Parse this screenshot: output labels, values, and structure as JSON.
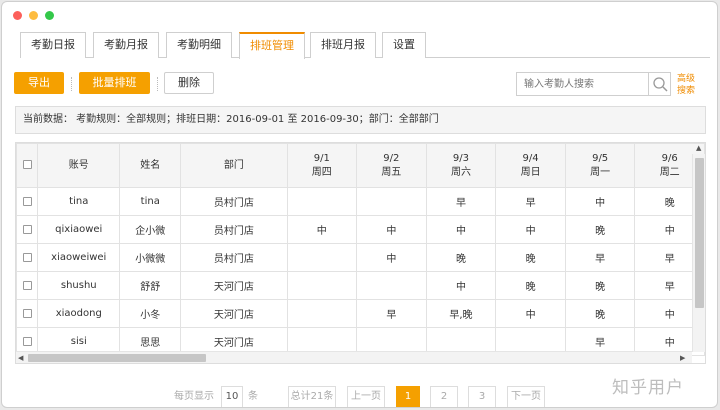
{
  "window": {
    "dot_colors": [
      "#fc605b",
      "#fdbc40",
      "#34c84a"
    ]
  },
  "tabs": [
    {
      "label": "考勤日报",
      "active": false
    },
    {
      "label": "考勤月报",
      "active": false
    },
    {
      "label": "考勤明细",
      "active": false
    },
    {
      "label": "排班管理",
      "active": true
    },
    {
      "label": "排班月报",
      "active": false
    },
    {
      "label": "设置",
      "active": false
    }
  ],
  "toolbar": {
    "export_label": "导出",
    "batch_label": "批量排班",
    "delete_label": "删除",
    "search_placeholder": "输入考勤人搜索",
    "advanced_search_label": "高级搜索"
  },
  "filter_info": "当前数据： 考勤规则：全部规则；排班日期：2016-09-01 至 2016-09-30；部门：全部部门",
  "table": {
    "columns": {
      "account": "账号",
      "name": "姓名",
      "department": "部门"
    },
    "dates": [
      {
        "date": "9/1",
        "weekday": "周四"
      },
      {
        "date": "9/2",
        "weekday": "周五"
      },
      {
        "date": "9/3",
        "weekday": "周六"
      },
      {
        "date": "9/4",
        "weekday": "周日"
      },
      {
        "date": "9/5",
        "weekday": "周一"
      },
      {
        "date": "9/6",
        "weekday": "周二"
      }
    ],
    "rows": [
      {
        "account": "tina",
        "name": "tina",
        "department": "员村门店",
        "shifts": [
          "",
          "",
          "早",
          "早",
          "中",
          "晚"
        ]
      },
      {
        "account": "qixiaowei",
        "name": "企小微",
        "department": "员村门店",
        "shifts": [
          "中",
          "中",
          "中",
          "中",
          "晚",
          "中"
        ]
      },
      {
        "account": "xiaoweiwei",
        "name": "小微微",
        "department": "员村门店",
        "shifts": [
          "",
          "中",
          "晚",
          "晚",
          "早",
          "早"
        ]
      },
      {
        "account": "shushu",
        "name": "舒舒",
        "department": "天河门店",
        "shifts": [
          "",
          "",
          "中",
          "晚",
          "晚",
          "早"
        ]
      },
      {
        "account": "xiaodong",
        "name": "小冬",
        "department": "天河门店",
        "shifts": [
          "",
          "早",
          "早,晚",
          "中",
          "晚",
          "中"
        ]
      },
      {
        "account": "sisi",
        "name": "思思",
        "department": "天河门店",
        "shifts": [
          "",
          "",
          "",
          "",
          "早",
          "中"
        ]
      }
    ]
  },
  "pagination": {
    "per_page_label": "每页显示",
    "per_page_value": "10",
    "per_page_unit": "条",
    "total_label": "总计21条",
    "prev_label": "上一页",
    "pages": [
      "1",
      "2",
      "3"
    ],
    "current_page": "1",
    "next_label": "下一页"
  },
  "watermark": "知乎用户"
}
